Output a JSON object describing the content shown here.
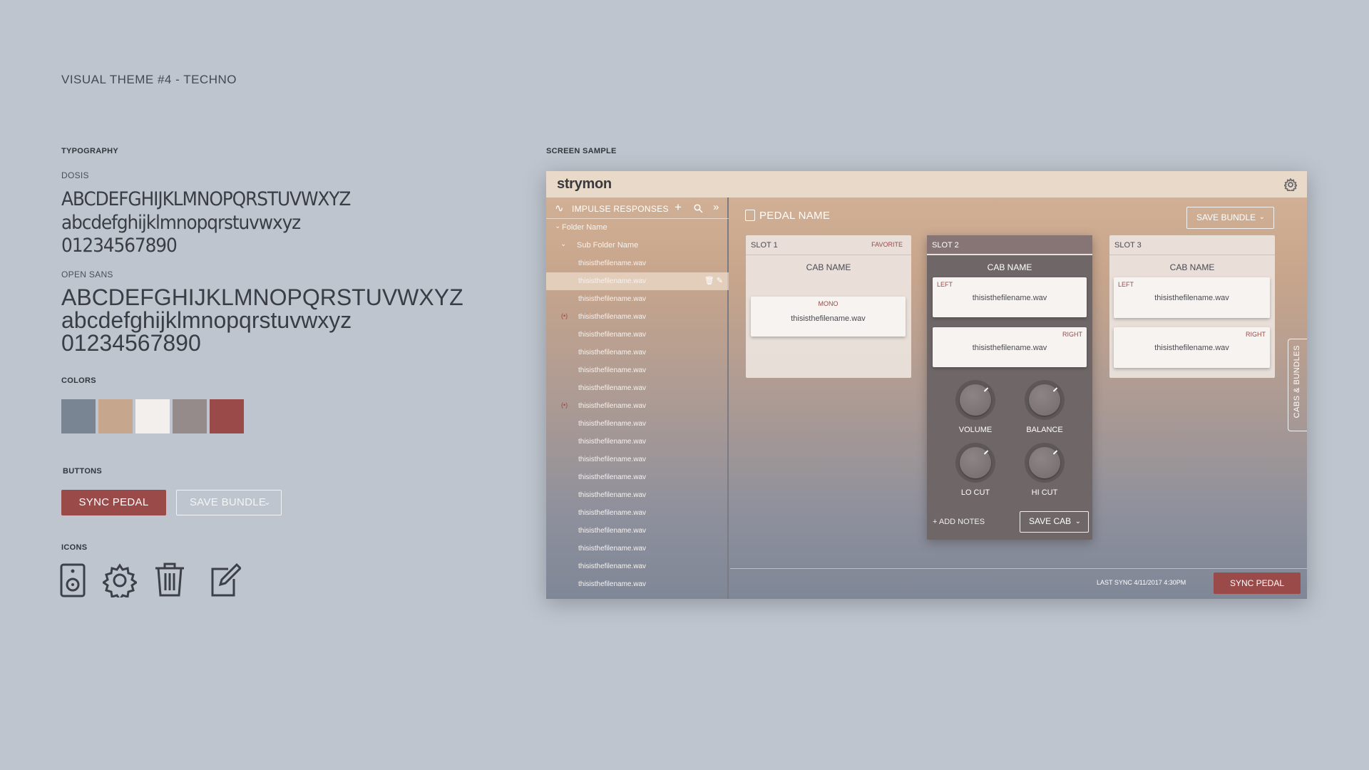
{
  "page_title": "VISUAL THEME #4 - TECHNO",
  "typography": {
    "label": "TYPOGRAPHY",
    "fonts": [
      {
        "name": "DOSIS",
        "upper": "ABCDEFGHIJKLMNOPQRSTUVWXYZ",
        "lower": "abcdefghijklmnopqrstuvwxyz",
        "digits": "01234567890"
      },
      {
        "name": "OPEN SANS",
        "upper": "ABCDEFGHIJKLMNOPQRSTUVWXYZ",
        "lower": "abcdefghijklmnopqrstuvwxyz",
        "digits": "01234567890"
      }
    ]
  },
  "colors": {
    "label": "COLORS",
    "swatches": [
      "#7a8593",
      "#c6a68c",
      "#f2efed",
      "#958b8b",
      "#9a4a48"
    ]
  },
  "buttons": {
    "label": "BUTTONS",
    "sync_pedal": "SYNC PEDAL",
    "save_bundle": "SAVE BUNDLE"
  },
  "icons": {
    "label": "ICONS",
    "items": [
      "speaker-icon",
      "gear-icon",
      "trash-icon",
      "edit-icon"
    ]
  },
  "screen_sample": {
    "label": "SCREEN SAMPLE",
    "brand": "strymon",
    "sidebar": {
      "title": "IMPULSE RESPONSES",
      "folder": "Folder Name",
      "subfolder": "Sub Folder Name",
      "files": [
        "thisisthefilename.wav",
        "thisisthefilename.wav",
        "thisisthefilename.wav",
        "thisisthefilename.wav",
        "thisisthefilename.wav",
        "thisisthefilename.wav",
        "thisisthefilename.wav",
        "thisisthefilename.wav",
        "thisisthefilename.wav",
        "thisisthefilename.wav",
        "thisisthefilename.wav",
        "thisisthefilename.wav",
        "thisisthefilename.wav",
        "thisisthefilename.wav",
        "thisisthefilename.wav",
        "thisisthefilename.wav",
        "thisisthefilename.wav",
        "thisisthefilename.wav",
        "thisisthefilename.wav"
      ]
    },
    "main": {
      "pedal_name": "PEDAL NAME",
      "save_bundle": "SAVE BUNDLE",
      "slots": [
        {
          "name": "SLOT 1",
          "favorite": "FAVORITE",
          "cab": "CAB NAME",
          "mono_tag": "MONO",
          "mono_file": "thisisthefilename.wav"
        },
        {
          "name": "SLOT 2",
          "cab": "CAB NAME",
          "left_tag": "LEFT",
          "left_file": "thisisthefilename.wav",
          "right_tag": "RIGHT",
          "right_file": "thisisthefilename.wav",
          "knobs": [
            "VOLUME",
            "BALANCE",
            "LO CUT",
            "HI CUT"
          ],
          "add_notes": "+ ADD NOTES",
          "save_cab": "SAVE CAB"
        },
        {
          "name": "SLOT 3",
          "cab": "CAB NAME",
          "left_tag": "LEFT",
          "left_file": "thisisthefilename.wav",
          "right_tag": "RIGHT",
          "right_file": "thisisthefilename.wav"
        }
      ],
      "side_tab": "CABS & BUNDLES",
      "last_sync": "LAST SYNC  4/11/2017  4:30PM",
      "sync_pedal": "SYNC PEDAL"
    }
  }
}
